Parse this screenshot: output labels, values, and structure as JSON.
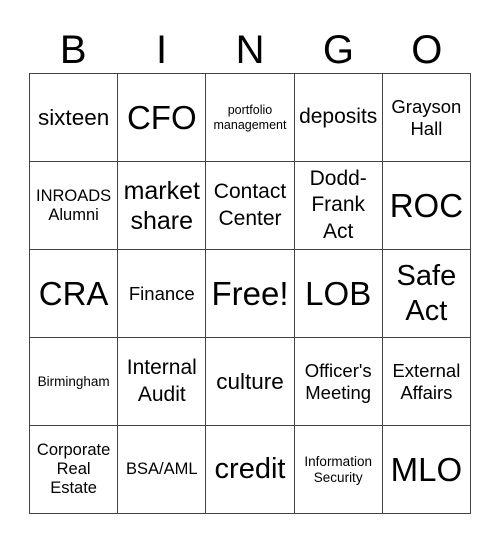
{
  "header": {
    "letters": [
      "B",
      "I",
      "N",
      "G",
      "O"
    ]
  },
  "card": {
    "rows": [
      [
        "sixteen",
        "CFO",
        "portfolio\nmanagement",
        "deposits",
        "Grayson\nHall"
      ],
      [
        "INROADS\nAlumni",
        "market\nshare",
        "Contact\nCenter",
        "Dodd-\nFrank\nAct",
        "ROC"
      ],
      [
        "CRA",
        "Finance",
        "Free!",
        "LOB",
        "Safe\nAct"
      ],
      [
        "Birmingham",
        "Internal\nAudit",
        "culture",
        "Officer's\nMeeting",
        "External\nAffairs"
      ],
      [
        "Corporate\nReal\nEstate",
        "BSA/AML",
        "credit",
        "Information\nSecurity",
        "MLO"
      ]
    ]
  }
}
